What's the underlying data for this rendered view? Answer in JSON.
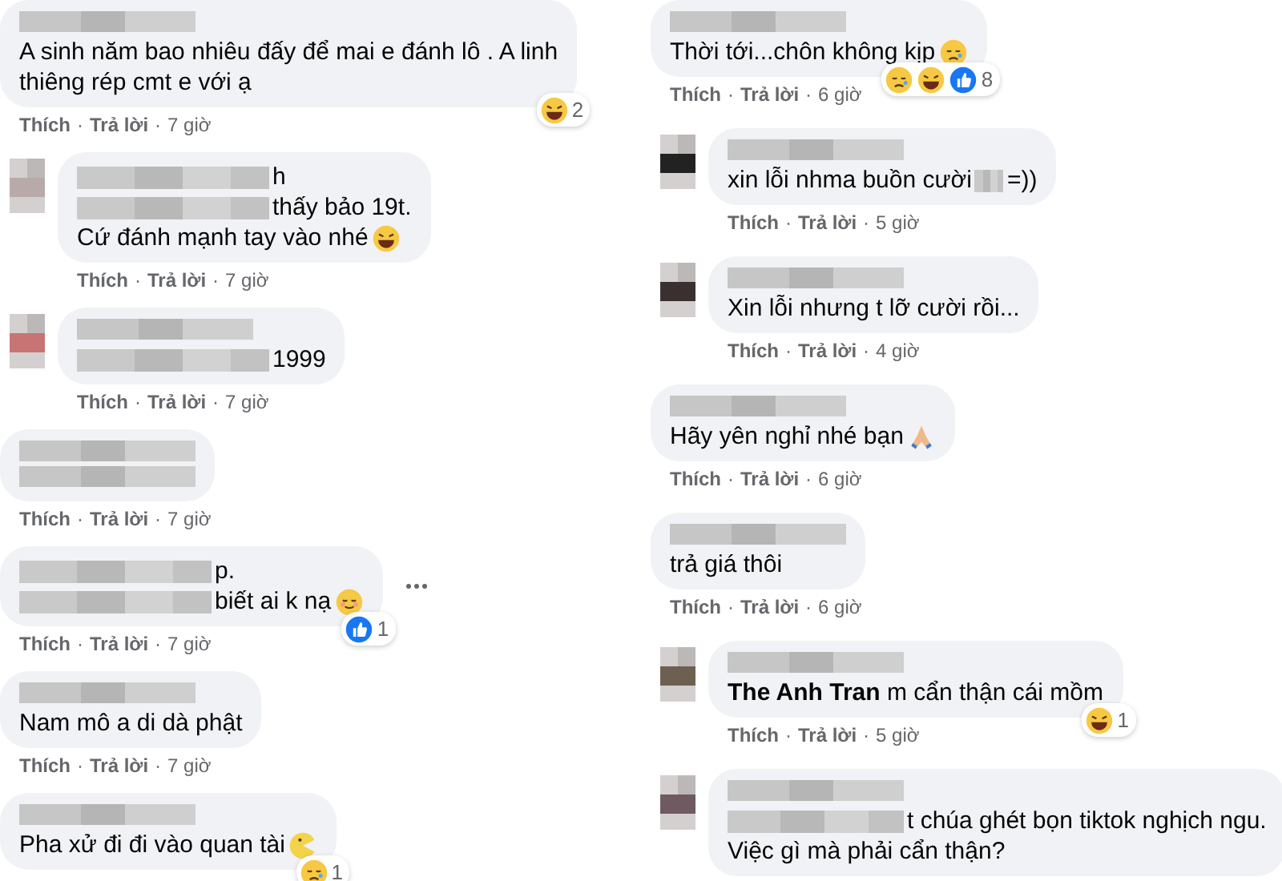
{
  "separator": "·",
  "columns": [
    {
      "comments": [
        {
          "reply": false,
          "name_blurred": true,
          "lines": [
            {
              "text": "A sinh năm bao nhiêu đấy để mai e đánh lô . A linh"
            },
            {
              "text": "thiêng rép cmt e với ạ"
            }
          ],
          "reactions": {
            "icons": [
              {
                "kind": "haha"
              }
            ],
            "count": "2"
          },
          "actions": [
            "Thích",
            "Trả lời",
            "7 giờ"
          ]
        },
        {
          "reply": true,
          "avatar": {
            "color": "#b9aaaa"
          },
          "name_blurred": false,
          "lines": [
            {
              "text": "h",
              "redacted_before": true
            },
            {
              "text": "thấy bảo 19t.",
              "redacted_before": true
            },
            {
              "text": "Cứ đánh mạnh tay vào nhé",
              "emoji": {
                "kind": "grin"
              }
            }
          ],
          "actions": [
            "Thích",
            "Trả lời",
            "7 giờ"
          ]
        },
        {
          "reply": true,
          "avatar": {
            "color": "#c87474"
          },
          "name_blurred": true,
          "lines": [
            {
              "text": "1999",
              "redacted_before": true
            }
          ],
          "actions": [
            "Thích",
            "Trả lời",
            "7 giờ"
          ]
        },
        {
          "reply": false,
          "name_blurred": true,
          "actions": [
            "Thích",
            "Trả lời",
            "7 giờ"
          ]
        },
        {
          "reply": false,
          "name_blurred": false,
          "menu": true,
          "lines": [
            {
              "text": "p.",
              "redacted_before": true
            },
            {
              "text": "biết ai k nạ",
              "redacted_before": true,
              "emoji": {
                "kind": "relieved"
              }
            }
          ],
          "reactions": {
            "icons": [
              {
                "kind": "like"
              }
            ],
            "count": "1"
          },
          "actions": [
            "Thích",
            "Trả lời",
            "7 giờ"
          ]
        },
        {
          "reply": false,
          "name_blurred": true,
          "lines": [
            {
              "text": "Nam mô a di dà phật"
            }
          ],
          "actions": [
            "Thích",
            "Trả lời",
            "7 giờ"
          ]
        },
        {
          "reply": false,
          "name_blurred": true,
          "lines": [
            {
              "text": "Pha xử đi đi vào quan tài",
              "emoji": {
                "kind": "moon"
              }
            }
          ],
          "reactions": {
            "icons": [
              {
                "kind": "sad"
              }
            ],
            "count": "1"
          }
        }
      ]
    },
    {
      "comments": [
        {
          "reply": false,
          "name_blurred": true,
          "lines": [
            {
              "text": "Thời tới...chôn không kịp",
              "emoji": {
                "kind": "sleepy"
              }
            }
          ],
          "reactions": {
            "icons": [
              {
                "kind": "sad"
              },
              {
                "kind": "haha"
              },
              {
                "kind": "like"
              }
            ],
            "count": "8"
          },
          "actions": [
            "Thích",
            "Trả lời",
            "6 giờ"
          ]
        },
        {
          "reply": true,
          "avatar": {
            "color": "#222222"
          },
          "name_blurred": true,
          "lines": [
            {
              "text": "xin lỗi nhma buồn cười",
              "redacted_after": true,
              "tail": "=))"
            }
          ],
          "actions": [
            "Thích",
            "Trả lời",
            "5 giờ"
          ]
        },
        {
          "reply": true,
          "avatar": {
            "color": "#3a3030"
          },
          "name_blurred": true,
          "lines": [
            {
              "text": "Xin lỗi nhưng t lỡ cười rồi..."
            }
          ],
          "actions": [
            "Thích",
            "Trả lời",
            "4 giờ"
          ]
        },
        {
          "reply": false,
          "name_blurred": true,
          "lines": [
            {
              "text": "Hãy yên nghỉ nhé bạn",
              "emoji": {
                "kind": "pray"
              }
            }
          ],
          "actions": [
            "Thích",
            "Trả lời",
            "6 giờ"
          ]
        },
        {
          "reply": false,
          "name_blurred": true,
          "lines": [
            {
              "text": "trả giá thôi"
            }
          ],
          "actions": [
            "Thích",
            "Trả lời",
            "6 giờ"
          ]
        },
        {
          "reply": true,
          "avatar": {
            "color": "#6e6050"
          },
          "name_blurred": true,
          "lines": [
            {
              "text": "**The Anh Tran** m cẩn thận cái mồm"
            }
          ],
          "reactions": {
            "icons": [
              {
                "kind": "haha"
              }
            ],
            "count": "1"
          },
          "actions": [
            "Thích",
            "Trả lời",
            "5 giờ"
          ]
        },
        {
          "reply": true,
          "avatar": {
            "color": "#6e5a60"
          },
          "name_blurred": true,
          "lines": [
            {
              "text": "t chúa ghét bọn tiktok nghịch ngu.",
              "redacted_before": true
            },
            {
              "text": "Việc gì mà phải cẩn thận?"
            }
          ]
        }
      ]
    }
  ]
}
